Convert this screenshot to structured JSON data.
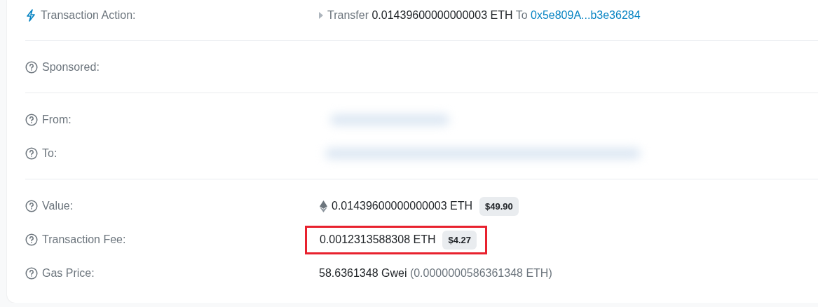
{
  "sections": [
    {
      "rows": [
        {
          "kind": "action",
          "label": "Transaction Action:",
          "verb": "Transfer",
          "amount": "0.01439600000000003 ETH",
          "preposition": "To",
          "address": "0x5e809A...b3e36284"
        }
      ]
    },
    {
      "rows": [
        {
          "kind": "empty",
          "label": "Sponsored:"
        }
      ]
    },
    {
      "rows": [
        {
          "kind": "redacted",
          "label": "From:"
        },
        {
          "kind": "redacted",
          "label": "To:"
        }
      ]
    },
    {
      "rows": [
        {
          "kind": "amount",
          "label": "Value:",
          "eth_icon": true,
          "amount": "0.01439600000000003 ETH",
          "usd": "$49.90",
          "highlighted": false
        },
        {
          "kind": "amount",
          "label": "Transaction Fee:",
          "eth_icon": false,
          "amount": "0.0012313588308 ETH",
          "usd": "$4.27",
          "highlighted": true
        },
        {
          "kind": "gas",
          "label": "Gas Price:",
          "gwei": "58.6361348 Gwei",
          "eth": "(0.0000000586361348 ETH)"
        }
      ]
    }
  ]
}
